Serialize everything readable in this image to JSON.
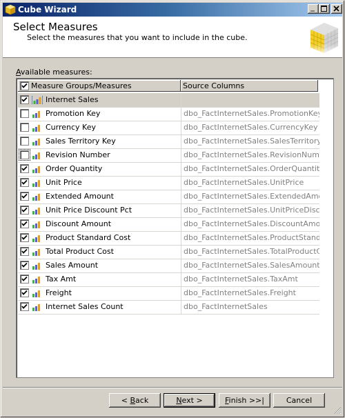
{
  "window": {
    "title": "Cube Wizard",
    "controls": {
      "minimize": "_",
      "maximize": "□",
      "close": "×"
    }
  },
  "header": {
    "title": "Select Measures",
    "subtitle": "Select the measures that you want to include in the cube.",
    "icon": "cube-icon"
  },
  "measures": {
    "label": "Available measures:",
    "label_mnemonic": "A",
    "columns": [
      "Measure Groups/Measures",
      "Source Columns"
    ],
    "header_checked": true,
    "group": {
      "name": "Internet Sales",
      "checked": true,
      "source": ""
    },
    "rows": [
      {
        "name": "Promotion Key",
        "source": "dbo_FactInternetSales.PromotionKey",
        "checked": false
      },
      {
        "name": "Currency Key",
        "source": "dbo_FactInternetSales.CurrencyKey",
        "checked": false
      },
      {
        "name": "Sales Territory Key",
        "source": "dbo_FactInternetSales.SalesTerritory...",
        "checked": false
      },
      {
        "name": "Revision Number",
        "source": "dbo_FactInternetSales.RevisionNumber",
        "checked": false,
        "focused": true
      },
      {
        "name": "Order Quantity",
        "source": "dbo_FactInternetSales.OrderQuantity",
        "checked": true
      },
      {
        "name": "Unit Price",
        "source": "dbo_FactInternetSales.UnitPrice",
        "checked": true
      },
      {
        "name": "Extended Amount",
        "source": "dbo_FactInternetSales.ExtendedAmo...",
        "checked": true
      },
      {
        "name": "Unit Price Discount Pct",
        "source": "dbo_FactInternetSales.UnitPriceDisco...",
        "checked": true
      },
      {
        "name": "Discount Amount",
        "source": "dbo_FactInternetSales.DiscountAmount",
        "checked": true
      },
      {
        "name": "Product Standard Cost",
        "source": "dbo_FactInternetSales.ProductStand...",
        "checked": true
      },
      {
        "name": "Total Product Cost",
        "source": "dbo_FactInternetSales.TotalProductC...",
        "checked": true
      },
      {
        "name": "Sales Amount",
        "source": "dbo_FactInternetSales.SalesAmount",
        "checked": true
      },
      {
        "name": "Tax Amt",
        "source": "dbo_FactInternetSales.TaxAmt",
        "checked": true
      },
      {
        "name": "Freight",
        "source": "dbo_FactInternetSales.Freight",
        "checked": true
      },
      {
        "name": "Internet Sales Count",
        "source": "dbo_FactInternetSales",
        "checked": true
      }
    ]
  },
  "buttons": {
    "back": "< Back",
    "next": "Next >",
    "finish": "Finish >>|",
    "cancel": "Cancel"
  }
}
